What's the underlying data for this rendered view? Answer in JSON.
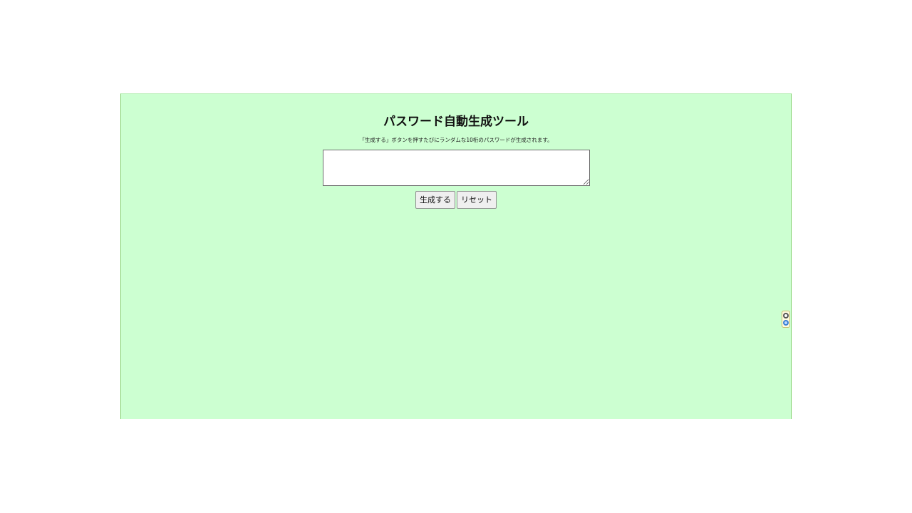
{
  "page": {
    "title": "パスワード自動生成ツール",
    "description": "「生成する」ボタンを押すたびにランダムな10桁のパスワードが生成されます。",
    "output_value": ""
  },
  "buttons": {
    "generate_label": "生成する",
    "reset_label": "リセット"
  },
  "side_widget": {
    "icons": [
      "gear-icon",
      "target-icon"
    ]
  },
  "colors": {
    "panel_background": "#ccffd1",
    "panel_border": "#7fd16b",
    "page_background": "#ffffff"
  }
}
